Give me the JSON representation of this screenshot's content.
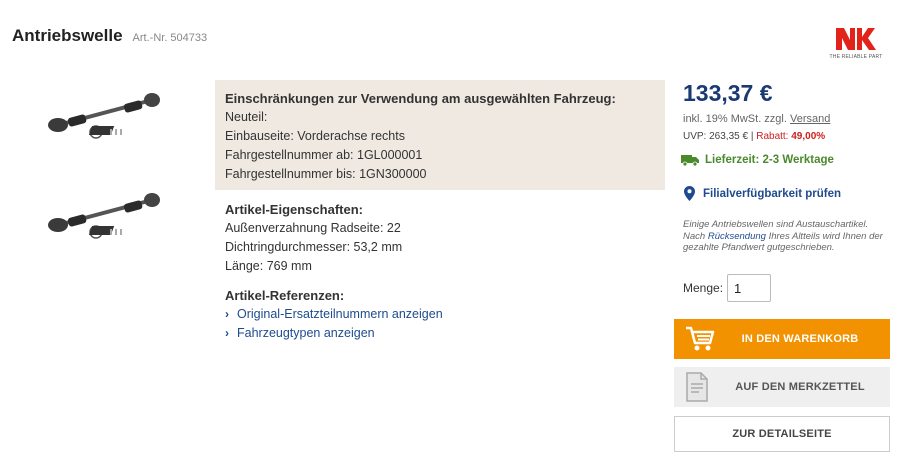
{
  "header": {
    "title": "Antriebswelle",
    "art_nr": "Art.-Nr. 504733"
  },
  "brand": {
    "logo_icon": "nk-logo-icon",
    "slogan": "THE RELIABLE PART",
    "color": "#e2231a"
  },
  "images": [
    {
      "icon": "drive-shaft-image"
    },
    {
      "icon": "drive-shaft-image"
    }
  ],
  "restrictions": {
    "title": "Einschränkungen zur Verwendung am ausgewählten Fahrzeug:",
    "lines": [
      "Neuteil:",
      "Einbauseite: Vorderachse rechts",
      "Fahrgestellnummer ab: 1GL000001",
      "Fahrgestellnummer bis: 1GN300000"
    ]
  },
  "properties": {
    "title": "Artikel-Eigenschaften:",
    "lines": [
      "Außenverzahnung Radseite: 22",
      "Dichtringdurchmesser: 53,2 mm",
      "Länge: 769 mm"
    ]
  },
  "references": {
    "title": "Artikel-Referenzen:",
    "links": [
      "Original-Ersatzteilnummern anzeigen",
      "Fahrzeugtypen anzeigen"
    ]
  },
  "pricing": {
    "price": "133,37 €",
    "tax_text": "inkl. 19% MwSt. zzgl.",
    "shipping_link": "Versand",
    "uvp": "UVP: 263,35 €",
    "separator": "|",
    "rabatt_label": "Rabatt:",
    "rabatt_value": "49,00%",
    "price_color": "#1b3a73"
  },
  "delivery": {
    "text": "Lieferzeit: 2-3 Werktage",
    "icon": "truck-icon",
    "color": "#4a8a2d"
  },
  "branch": {
    "text": "Filialverfügbarkeit prüfen",
    "icon": "location-pin-icon"
  },
  "note": {
    "part1": "Einige Antriebswellen sind Austauschartikel. Nach",
    "link": "Rücksendung",
    "part2": "Ihres Altteils wird Ihnen der gezahlte Pfandwert gutgeschrieben."
  },
  "quantity": {
    "label": "Menge:",
    "value": "1"
  },
  "buttons": {
    "cart": "IN DEN WARENKORB",
    "cart_icon": "shopping-cart-icon",
    "cart_color": "#f29200",
    "memo": "AUF DEN MERKZETTEL",
    "memo_icon": "notepad-icon",
    "detail": "ZUR DETAILSEITE"
  }
}
